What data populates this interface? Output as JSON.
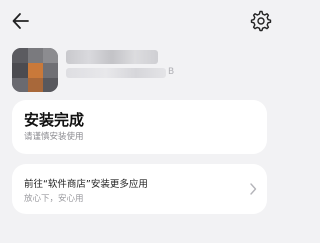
{
  "header": {
    "back_icon": "arrow-left-icon",
    "settings_icon": "gear-icon"
  },
  "app": {
    "meta_suffix": "B"
  },
  "install_card": {
    "title": "安装完成",
    "subtitle": "请谨慎安装使用"
  },
  "store_card": {
    "title": "前往“软件商店”安装更多应用",
    "subtitle": "放心下，安心用",
    "chevron_icon": "chevron-right-icon"
  },
  "colors": {
    "background": "#f2f2f4",
    "card": "#ffffff"
  }
}
